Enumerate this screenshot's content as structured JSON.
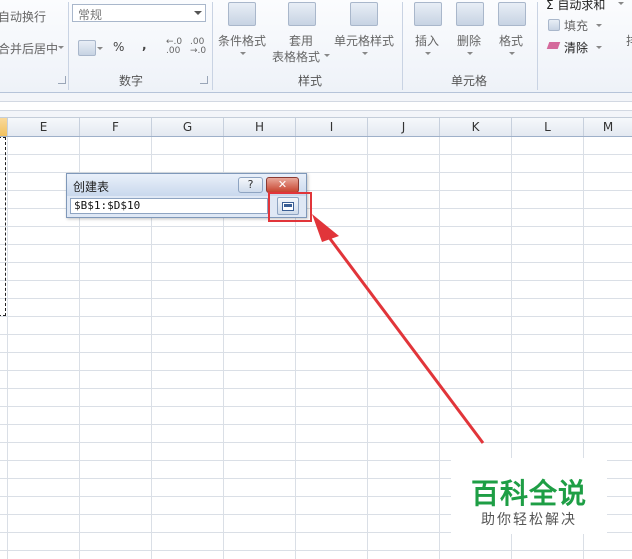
{
  "ribbon": {
    "alignment": {
      "wrap_text": "自动换行",
      "merge_center": "合并后居中"
    },
    "number": {
      "format_value": "常规",
      "percent": "%",
      "comma": ",",
      "increase_decimal": "←.0\n.00",
      "decrease_decimal": ".00\n→.0",
      "group_label": "数字"
    },
    "styles": {
      "conditional_format": "条件格式",
      "format_as_table_line1": "套用",
      "format_as_table_line2": "表格格式",
      "cell_styles": "单元格样式",
      "group_label": "样式"
    },
    "cells": {
      "insert": "插入",
      "delete": "删除",
      "format": "格式",
      "group_label": "单元格"
    },
    "editing": {
      "autosum": "Σ 自动求和",
      "fill": "填充",
      "clear": "清除"
    }
  },
  "sheet": {
    "columns": [
      "E",
      "F",
      "G",
      "H",
      "I",
      "J",
      "K",
      "L",
      "M"
    ]
  },
  "dialog": {
    "title": "创建表",
    "help": "?",
    "close": "✕",
    "range_value": "$B$1:$D$10"
  },
  "watermark": {
    "title": "百科全说",
    "subtitle": "助你轻松解决"
  },
  "colors": {
    "annotation_red": "#e1353a",
    "watermark_green": "#1e9e45",
    "selected_column": "#f1c15f"
  }
}
